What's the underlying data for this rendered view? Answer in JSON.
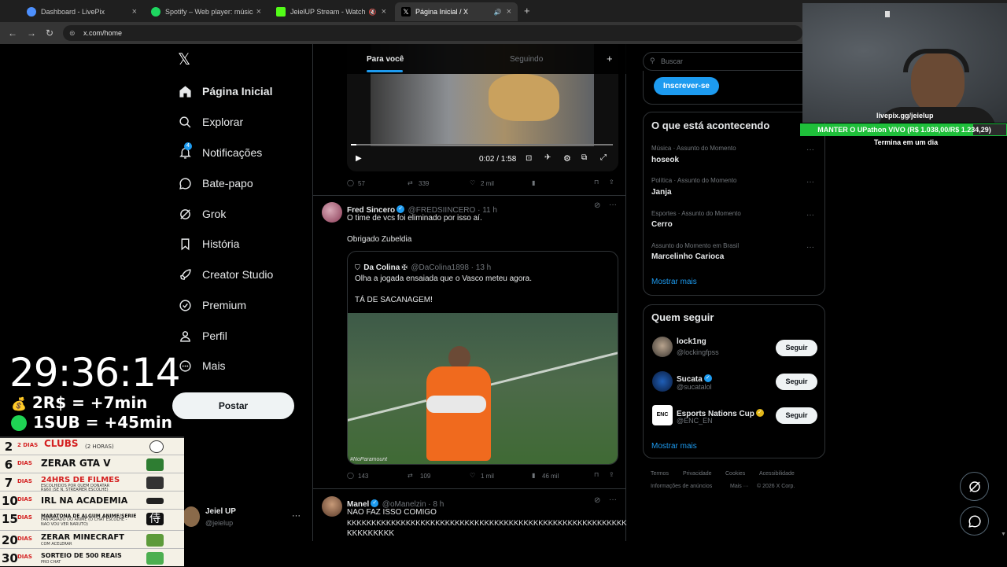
{
  "browser": {
    "tabs": [
      {
        "label": "Dashboard - LivePix",
        "color": "#4d90fe"
      },
      {
        "label": "Spotify – Web player: música p",
        "color": "#1ed760"
      },
      {
        "label": "JeielUP Stream - Watch Live",
        "color": "#53fc18"
      },
      {
        "label": "Página Inicial / X",
        "color": "#ffffff"
      }
    ],
    "new_tab": "+",
    "url": "x.com/home"
  },
  "sidebar": {
    "items": [
      {
        "label": "Página Inicial",
        "icon": "home-icon"
      },
      {
        "label": "Explorar",
        "icon": "search-icon"
      },
      {
        "label": "Notificações",
        "icon": "bell-icon",
        "badge": "4"
      },
      {
        "label": "Bate-papo",
        "icon": "chat-icon"
      },
      {
        "label": "Grok",
        "icon": "grok-icon"
      },
      {
        "label": "História",
        "icon": "bookmark-icon"
      },
      {
        "label": "Creator Studio",
        "icon": "rocket-icon"
      },
      {
        "label": "Premium",
        "icon": "verified-icon"
      },
      {
        "label": "Perfil",
        "icon": "person-icon"
      },
      {
        "label": "Mais",
        "icon": "more-circle-icon"
      }
    ],
    "post_label": "Postar",
    "account": {
      "name": "Jeiel UP",
      "handle": "@jeielup",
      "more": "···"
    }
  },
  "timeline": {
    "tabs": [
      "Para você",
      "Seguindo"
    ],
    "video": {
      "time": "0:02 / 1:58",
      "progress": 0.02
    },
    "first_actions": {
      "replies": "57",
      "reposts": "339",
      "likes": "2 mil"
    },
    "tweet1": {
      "name": "Fred Sincero",
      "handle": "@FREDSIINCERO · 11 h",
      "text1": "O time de vcs foi eliminado por isso aí.",
      "text2": "Obrigado Zubeldia",
      "quote": {
        "name": "Da Colina",
        "handle": "@DaColina1898 · 13 h",
        "text1": "Olha a jogada ensaiada que o Vasco meteu agora.",
        "text2": "TÁ DE SACANAGEM!",
        "watermark": "#NoParamount"
      },
      "actions": {
        "replies": "143",
        "reposts": "109",
        "likes": "1 mil",
        "views": "46 mil"
      }
    },
    "tweet2": {
      "name": "Manel",
      "handle": "@oManelzin · 8 h",
      "text1": "NAO FAZ ISSO COMIGO",
      "text2": "KKKKKKKKKKKKKKKKKKKKKKKKKKKKKKKKKKKKKKKKKKKKKKKKKKKKKKKKK",
      "text3": "KKKKKKKKK"
    }
  },
  "right": {
    "search_placeholder": "Buscar",
    "subscribe_label": "Inscrever-se",
    "trends_title": "O que está acontecendo",
    "trends": [
      {
        "category": "Música · Assunto do Momento",
        "name": "hoseok"
      },
      {
        "category": "Política · Assunto do Momento",
        "name": "Janja"
      },
      {
        "category": "Esportes · Assunto do Momento",
        "name": "Cerro"
      },
      {
        "category": "Assunto do Momento em Brasil",
        "name": "Marcelinho Carioca"
      }
    ],
    "show_more": "Mostrar mais",
    "who_title": "Quem seguir",
    "who": [
      {
        "name": "lock1ng",
        "handle": "@lockingfpss",
        "verified": false
      },
      {
        "name": "Sucata",
        "handle": "@sucatalol",
        "verified": true
      },
      {
        "name": "Esports Nations Cup",
        "handle": "@ENC_EN",
        "verified": true
      }
    ],
    "follow_label": "Seguir",
    "footer": [
      "Termos",
      "Privacidade",
      "Cookies",
      "Acessibilidade",
      "Informações de anúncios",
      "Mais ···",
      "© 2026 X Corp."
    ]
  },
  "overlay": {
    "timer": "29:36:14",
    "rate1": "2R$ = +7min",
    "rate2": "1SUB = +45min",
    "goals": [
      {
        "num": "2",
        "dias": "2 DIAS",
        "text": "CLUBS",
        "sub": "(2 HORAS)"
      },
      {
        "num": "6",
        "dias": "DIAS",
        "text": "ZERAR GTA V",
        "sub": ""
      },
      {
        "num": "7",
        "dias": "DIAS",
        "text": "24HRS DE FILMES",
        "sub": "ESCOLHIDOS POR QUEM DONATAR R$60 (SE N, STREAMER ESCOLHE)"
      },
      {
        "num": "10",
        "dias": "DIAS",
        "text": "IRL NA ACADEMIA",
        "sub": ""
      },
      {
        "num": "15",
        "dias": "DIAS",
        "text": "MARATONA DE ALGUM ANIME/SERIE",
        "sub": "FANTASIADO DO ANIME (O CHAT ESCOLHE - NAO VOU VER NARUTO)"
      },
      {
        "num": "20",
        "dias": "DIAS",
        "text": "ZERAR MINECRAFT",
        "sub": "COM ACELERAR"
      },
      {
        "num": "30",
        "dias": "DIAS",
        "text": "SORTEIO DE 500 REAIS",
        "sub": "PRO CHAT"
      }
    ],
    "webcam_url": "livepix.gg/jeielup",
    "goal_bar": "MANTER O UPathon VIVO (R$ 1.038,00/R$ 1.234,29)",
    "goal_progress": 0.84,
    "goal_sub": "Termina em um dia"
  }
}
